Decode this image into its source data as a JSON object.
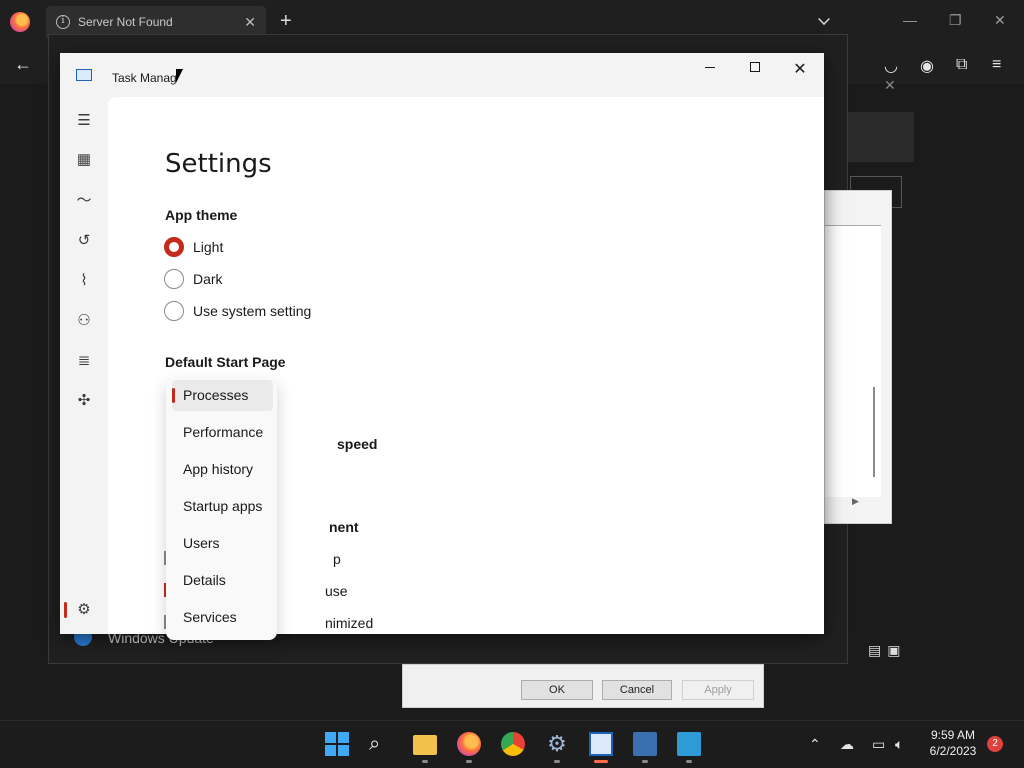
{
  "browser": {
    "tab_title": "Server Not Found",
    "tab_close": "✕",
    "new_tab": "+"
  },
  "background": {
    "windows_update_label": "Windows Update",
    "dialog_ok": "OK",
    "dialog_cancel": "Cancel",
    "dialog_apply": "Apply"
  },
  "task_manager": {
    "title": "Task Manag",
    "settings_heading": "Settings",
    "app_theme_heading": "App theme",
    "theme_options": [
      {
        "label": "Light",
        "selected": true
      },
      {
        "label": "Dark",
        "selected": false
      },
      {
        "label": "Use system setting",
        "selected": false
      }
    ],
    "default_start_page_heading": "Default Start Page",
    "partial_speed": "speed",
    "partial_ment": "nent",
    "partial_p": "p",
    "partial_use": "use",
    "partial_minimized": "nimized",
    "start_page_options": [
      "Processes",
      "Performance",
      "App history",
      "Startup apps",
      "Users",
      "Details",
      "Services"
    ],
    "start_page_selected": "Processes"
  },
  "taskbar": {
    "time": "9:59 AM",
    "date": "6/2/2023",
    "notification_count": "2"
  },
  "colors": {
    "accent": "#c42b1c",
    "taskbar": "#1c1c1c",
    "window_bg": "#f3f3f3"
  }
}
